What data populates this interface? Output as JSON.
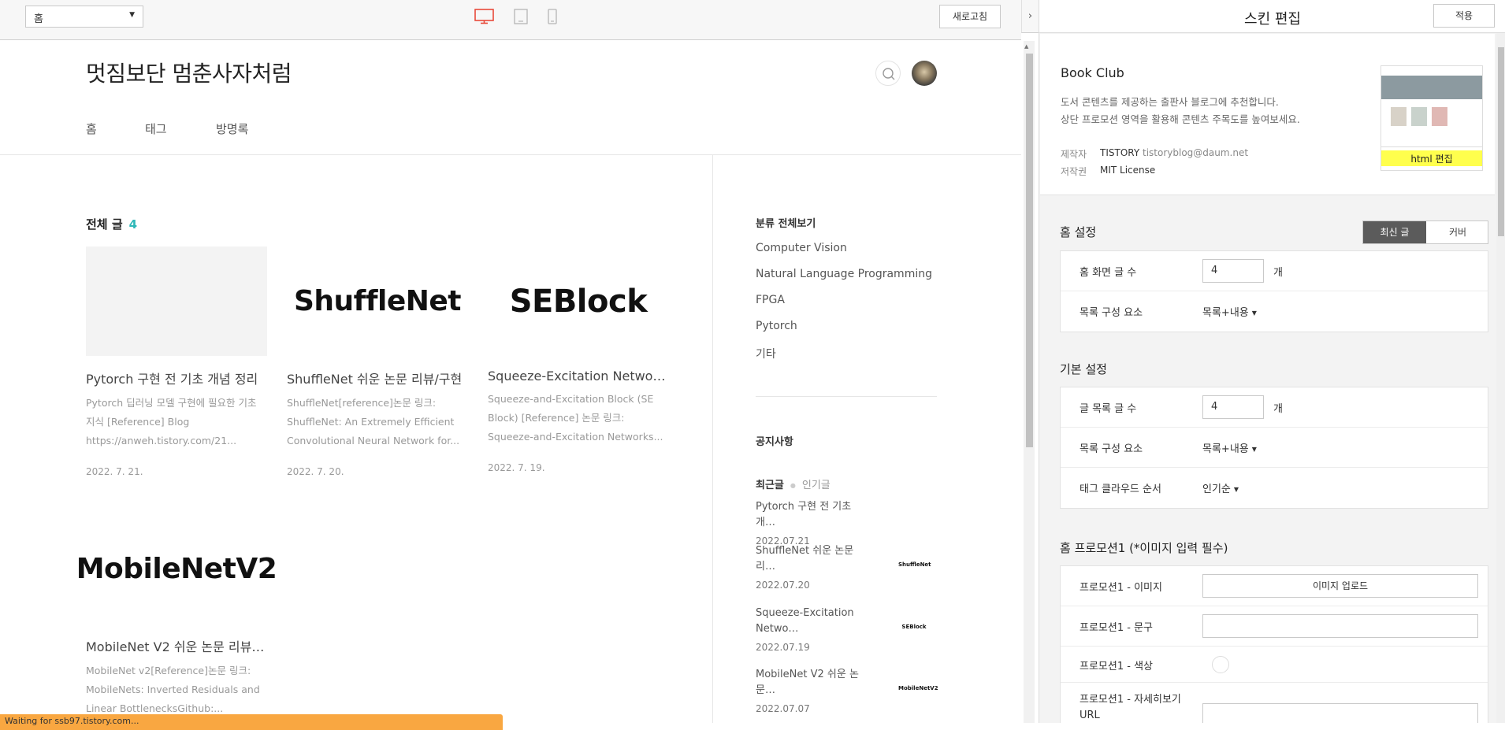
{
  "toolbar": {
    "page_select": "홈",
    "refresh_label": "새로고침",
    "accent_color": "#e8493a"
  },
  "blog": {
    "title": "멋짐보단 멈춘사자처럼",
    "nav": [
      "홈",
      "태그",
      "방명록"
    ],
    "section_title": "전체 글",
    "post_count": "4",
    "posts": [
      {
        "thumb": "",
        "title": "Pytorch 구현 전 기초 개념 정리",
        "excerpt": "Pytorch 딥러닝 모델 구현에 필요한 기초 지식 [Reference] Blog https://anweh.tistory.com/21...",
        "date": "2022. 7. 21."
      },
      {
        "thumb": "ShuffleNet",
        "title": "ShuffleNet 쉬운 논문 리뷰/구현",
        "excerpt": "ShuffleNet[reference]논문 링크: ShuffleNet: An Extremely Efficient Convolutional Neural Network for...",
        "date": "2022. 7. 20."
      },
      {
        "thumb": "SEBlock",
        "title": "Squeeze-Excitation Network...",
        "excerpt": "Squeeze-and-Excitation Block (SE Block) [Reference] 논문 링크: Squeeze-and-Excitation Networks...",
        "date": "2022. 7. 19."
      },
      {
        "thumb": "MobileNetV2",
        "title": "MobileNet V2 쉬운 논문 리뷰/...",
        "excerpt": "MobileNet v2[Reference]논문 링크: MobileNets: Inverted Residuals and Linear BottlenecksGithub:...",
        "date": ""
      }
    ],
    "sidebar": {
      "category_head": "분류 전체보기",
      "categories": [
        "Computer Vision",
        "Natural Language Programming",
        "FPGA",
        "Pytorch",
        "기타"
      ],
      "notice_head": "공지사항",
      "tab_recent": "최근글",
      "tab_popular": "인기글",
      "recent": [
        {
          "title": "Pytorch 구현 전 기초 개…",
          "date": "2022.07.21",
          "thumb": ""
        },
        {
          "title": "ShuffleNet 쉬운 논문 리…",
          "date": "2022.07.20",
          "thumb": "ShuffleNet"
        },
        {
          "title": "Squeeze-Excitation Netwo…",
          "date": "2022.07.19",
          "thumb": "SEBlock"
        },
        {
          "title": "MobileNet V2 쉬운 논문…",
          "date": "2022.07.07",
          "thumb": "MobileNetV2"
        }
      ]
    },
    "status_text": "Waiting for ssb97.tistory.com..."
  },
  "panel": {
    "title": "스킨 편집",
    "apply_label": "적용",
    "skin_name": "Book Club",
    "skin_desc_1": "도서 콘텐츠를 제공하는 출판사 블로그에 추천합니다.",
    "skin_desc_2": "상단 프로모션 영역을 활용해 콘텐츠 주목도를 높여보세요.",
    "author_label": "제작자",
    "author": "TISTORY",
    "author_mail": "tistoryblog@daum.net",
    "license_label": "저작권",
    "license": "MIT License",
    "html_edit_label": "html 편집",
    "home_settings": {
      "title": "홈 설정",
      "toggle": [
        "최신 글",
        "커버"
      ],
      "post_count_label": "홈 화면 글 수",
      "post_count": "4",
      "unit": "개",
      "list_label": "목록 구성 요소",
      "list_value": "목록+내용"
    },
    "basic_settings": {
      "title": "기본 설정",
      "post_count_label": "글 목록 글 수",
      "post_count": "4",
      "unit": "개",
      "list_label": "목록 구성 요소",
      "list_value": "목록+내용",
      "tag_label": "태그 클라우드 순서",
      "tag_value": "인기순"
    },
    "promo": {
      "title": "홈 프로모션1 (*이미지 입력 필수)",
      "image_label": "프로모션1 - 이미지",
      "upload_label": "이미지 업로드",
      "text_label": "프로모션1 - 문구",
      "color_label": "프로모션1 - 색상",
      "url_label": "프로모션1 - 자세히보기 URL"
    }
  }
}
